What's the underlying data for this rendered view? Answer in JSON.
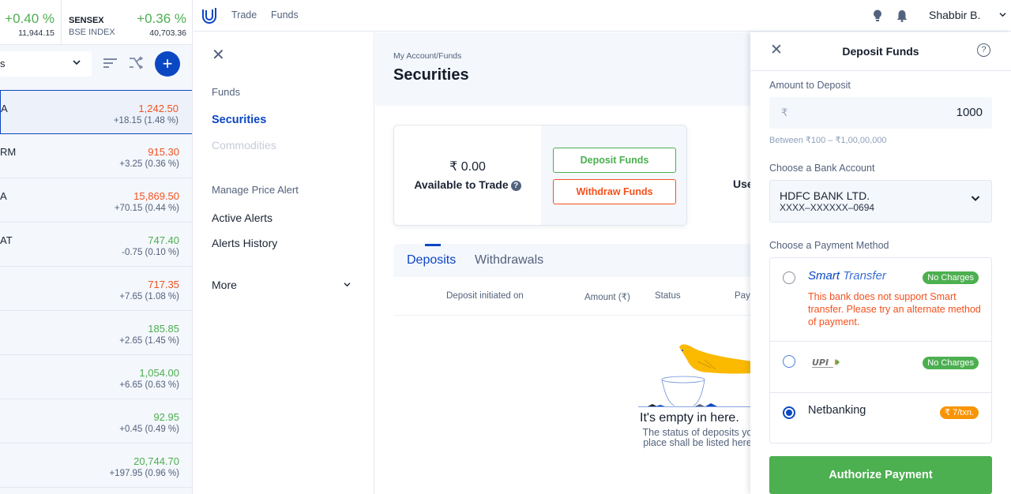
{
  "indices": [
    {
      "name": "",
      "exchange": "",
      "change_pct": "+0.40 %",
      "value": "11,944.15"
    },
    {
      "name": "SENSEX",
      "exchange": "BSE INDEX",
      "change_pct": "+0.36 %",
      "value": "40,703.36"
    }
  ],
  "watchlist": {
    "selected_list": "s",
    "rows": [
      {
        "symbol": "A",
        "price": "1,242.50",
        "change": "+18.15 (1.48 %)",
        "trend": "down"
      },
      {
        "symbol": "RM",
        "price": "915.30",
        "change": "+3.25 (0.36 %)",
        "trend": "down"
      },
      {
        "symbol": "A",
        "price": "15,869.50",
        "change": "+70.15 (0.44 %)",
        "trend": "down"
      },
      {
        "symbol": "AT",
        "price": "747.40",
        "change": "-0.75 (0.10 %)",
        "trend": "up"
      },
      {
        "symbol": "",
        "price": "717.35",
        "change": "+7.65 (1.08 %)",
        "trend": "down"
      },
      {
        "symbol": "",
        "price": "185.85",
        "change": "+2.65 (1.45 %)",
        "trend": "up"
      },
      {
        "symbol": "",
        "price": "1,054.00",
        "change": "+6.65 (0.63 %)",
        "trend": "up"
      },
      {
        "symbol": "",
        "price": "92.95",
        "change": "+0.45 (0.49 %)",
        "trend": "up"
      },
      {
        "symbol": "",
        "price": "20,744.70",
        "change": "+197.95 (0.96 %)",
        "trend": "up"
      }
    ],
    "add_label": "+"
  },
  "topnav": {
    "links": [
      "Trade",
      "Funds"
    ],
    "user_name": "Shabbir B.",
    "user_chevron": "⌄"
  },
  "account_menu": {
    "close": "✕",
    "items": [
      {
        "label": "Funds",
        "kind": "label"
      },
      {
        "label": "Securities",
        "kind": "active"
      },
      {
        "label": "Commodities",
        "kind": "disabled"
      },
      {
        "label": "Manage Price Alert",
        "kind": "label"
      },
      {
        "label": "Active Alerts",
        "kind": "link"
      },
      {
        "label": "Alerts History",
        "kind": "link"
      },
      {
        "label": "More",
        "kind": "link"
      }
    ],
    "more_chevron": "⌄"
  },
  "main": {
    "breadcrumb": "My Account/Funds",
    "title": "Securities",
    "balance": {
      "amount": "₹ 0.00",
      "label": "Available to Trade",
      "help": "?"
    },
    "deposit_button": "Deposit Funds",
    "withdraw_button": "Withdraw Funds",
    "use_label": "Use",
    "tabs": [
      "Deposits",
      "Withdrawals"
    ],
    "active_tab": "Deposits",
    "columns": [
      "Deposit initiated on",
      "Amount (₹)",
      "Status",
      "Pay"
    ],
    "empty": {
      "title": "It's empty in here.",
      "subtitle_line1": "The status of deposits yo",
      "subtitle_line2": "place shall be listed here"
    }
  },
  "deposit_panel": {
    "close": "✕",
    "title": "Deposit Funds",
    "help": "?",
    "amount_label": "Amount to Deposit",
    "currency_symbol": "₹",
    "amount_value": "1000",
    "amount_hint": "Between ₹100 – ₹1,00,00,000",
    "bank_label": "Choose a Bank Account",
    "bank_name": "HDFC BANK LTD.",
    "bank_account": "XXXX–XXXXXX–0694",
    "payment_label": "Choose a Payment Method",
    "methods": [
      {
        "name_part1": "Smart",
        "name_part2": "Transfer",
        "badge": "No Charges",
        "badge_color": "#4caf50",
        "selected": false,
        "error": "This bank does not support Smart transfer. Please try an alternate method of payment."
      },
      {
        "name": "UPI",
        "badge": "No Charges",
        "badge_color": "#4caf50",
        "selected": false
      },
      {
        "name": "Netbanking",
        "badge": "₹ 7/txn.",
        "badge_color": "#f89406",
        "selected": true
      }
    ],
    "authorize_button": "Authorize Payment"
  },
  "colors": {
    "brand_blue": "#0c47c3",
    "positive_green": "#4caf50",
    "negative_orange": "#f4511e",
    "fee_orange": "#f89406"
  }
}
